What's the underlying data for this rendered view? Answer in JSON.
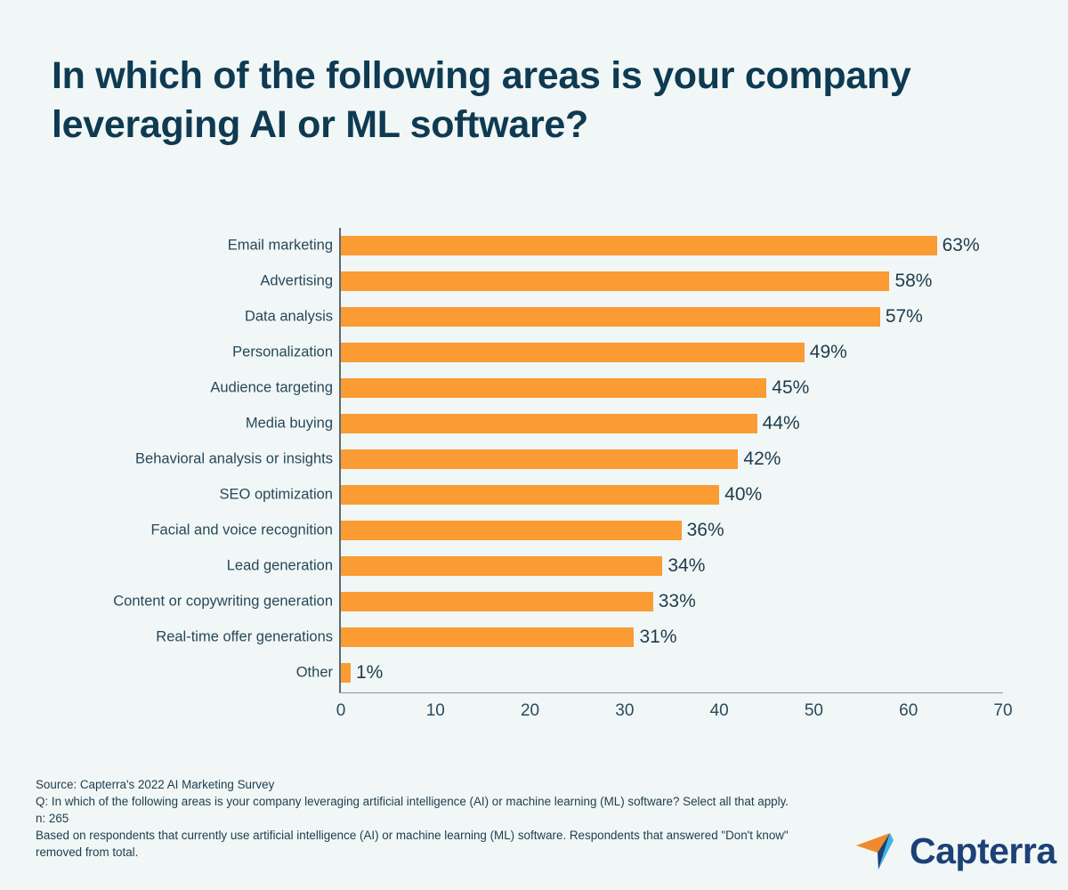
{
  "title": "In which of the following areas is your company leveraging AI or ML software?",
  "background_color": "#f1f7f6",
  "accent_color": "#fa9b33",
  "title_color": "#0e3a52",
  "chart_data": {
    "type": "bar",
    "orientation": "horizontal",
    "title": "In which of the following areas is your company leveraging AI or ML software?",
    "xlabel": "",
    "ylabel": "",
    "xlim": [
      0,
      70
    ],
    "xticks": [
      0,
      10,
      20,
      30,
      40,
      50,
      60,
      70
    ],
    "xtick_labels": [
      "0",
      "10",
      "20",
      "30",
      "40",
      "50",
      "60",
      "70"
    ],
    "grid": false,
    "legend": null,
    "bar_color": "#fa9b33",
    "value_suffix": "%",
    "categories": [
      "Email marketing",
      "Advertising",
      "Data analysis",
      "Personalization",
      "Audience targeting",
      "Media buying",
      "Behavioral analysis or insights",
      "SEO optimization",
      "Facial and voice recognition",
      "Lead generation",
      "Content or copywriting generation",
      "Real-time offer generations",
      "Other"
    ],
    "values": [
      63,
      58,
      57,
      49,
      45,
      44,
      42,
      40,
      36,
      34,
      33,
      31,
      1
    ],
    "value_labels": [
      "63%",
      "58%",
      "57%",
      "49%",
      "45%",
      "44%",
      "42%",
      "40%",
      "36%",
      "34%",
      "33%",
      "31%",
      "1%"
    ]
  },
  "footnote": {
    "line1": "Source: Capterra's 2022 AI Marketing Survey",
    "line2": "Q: In which of the following areas is your company leveraging artificial intelligence (AI) or machine learning (ML) software? Select all that apply.",
    "line3": "n: 265",
    "line4": "Based on respondents that currently use artificial intelligence (AI) or machine learning (ML) software. Respondents that answered \"Don't know\" removed from total."
  },
  "logo": {
    "wordmark": "Capterra",
    "mark_colors": [
      "#f2892f",
      "#42b4e6",
      "#1c4177"
    ]
  }
}
